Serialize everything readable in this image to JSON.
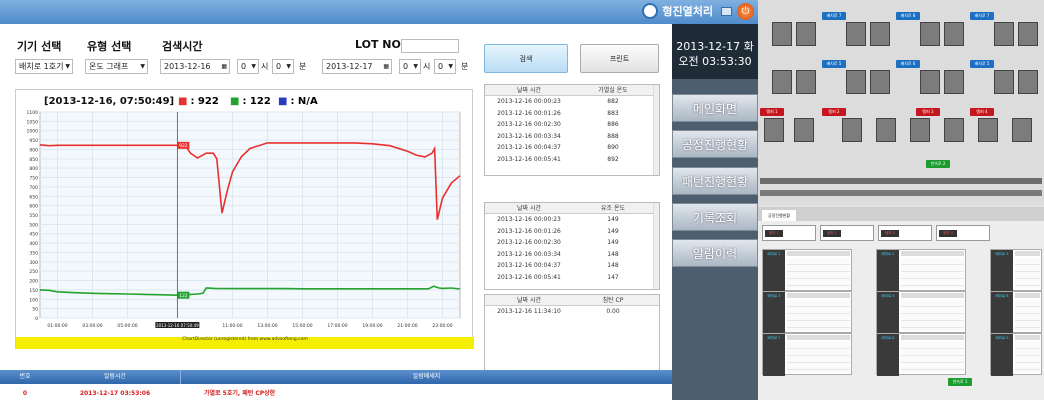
{
  "header": {
    "brand": "형진열처리"
  },
  "filters": {
    "device_label": "기기 선택",
    "type_label": "유형 선택",
    "time_label": "검색시간",
    "lot_label": "LOT NO",
    "device_value": "배치로 1호기",
    "type_value": "온도 그래프",
    "start_date": "2013-12-16",
    "start_hour": "0",
    "start_min": "0",
    "end_date": "2013-12-17",
    "end_hour": "0",
    "end_min": "0",
    "hour_unit": "시",
    "min_unit": "분",
    "lot_value": ""
  },
  "buttons": {
    "search": "검색",
    "print": "프린트"
  },
  "chart_readout": {
    "timestamp": "[2013-12-16,  07:50:49]",
    "red_label": "■",
    "red_value": ": 922",
    "green_label": "■",
    "green_value": ": 122",
    "blue_label": "■",
    "blue_value": ": N/A",
    "cursor_tag": "2013-12-16 07:50:49",
    "red_marker": "922",
    "green_marker": "122",
    "attribution": "ChartDirector (unregistered) from www.advsofteng.com"
  },
  "chart_data": {
    "type": "line",
    "ylim": [
      0,
      1100
    ],
    "y_ticks": [
      0,
      50,
      100,
      150,
      200,
      250,
      300,
      350,
      400,
      450,
      500,
      550,
      600,
      650,
      700,
      750,
      800,
      850,
      900,
      950,
      1000,
      1050,
      1100
    ],
    "x_ticks": [
      "01:00:00",
      "03:00:00",
      "05:00:00",
      "2013-12-16 07:50:49",
      "11:00:00",
      "13:00:00",
      "15:00:00",
      "17:00:00",
      "19:00:00",
      "21:00:00",
      "23:00:00"
    ],
    "grid": true,
    "series": [
      {
        "color": "#e8312f",
        "x": [
          0,
          0.5,
          1,
          2,
          3,
          4,
          5,
          6,
          7,
          7.85,
          8.3,
          8.6,
          9,
          9.5,
          9.9,
          10.1,
          10.4,
          10.7,
          11,
          11.5,
          12,
          13,
          14,
          15,
          16,
          17,
          18,
          19,
          20,
          21,
          21.5,
          22,
          22.4,
          22.55,
          22.7,
          23,
          23.5,
          24
        ],
        "y": [
          925,
          920,
          922,
          922,
          922,
          922,
          922,
          922,
          922,
          922,
          921,
          880,
          855,
          880,
          880,
          850,
          560,
          680,
          780,
          860,
          905,
          935,
          935,
          935,
          935,
          935,
          935,
          930,
          920,
          890,
          870,
          860,
          880,
          905,
          525,
          640,
          720,
          760
        ]
      },
      {
        "color": "#22a32e",
        "x": [
          0,
          0.5,
          1,
          2,
          3,
          4,
          5,
          6,
          7,
          7.85,
          8.5,
          9,
          9.3,
          9.5,
          10,
          11,
          12,
          13,
          14,
          15,
          16,
          17,
          18,
          19,
          20,
          21,
          22,
          22.2,
          22.5,
          22.8,
          23,
          23.5,
          24
        ],
        "y": [
          150,
          148,
          140,
          135,
          132,
          130,
          128,
          126,
          124,
          122,
          125,
          128,
          132,
          160,
          158,
          157,
          157,
          157,
          157,
          156,
          156,
          156,
          156,
          156,
          156,
          156,
          156,
          156,
          170,
          160,
          158,
          160,
          155
        ]
      },
      {
        "color": "#2a3bbf",
        "x": [],
        "y": []
      }
    ]
  },
  "tables": [
    {
      "col1": "날짜 시간",
      "col2": "가열실 온도",
      "rows": [
        [
          "2013-12-16 00:00:23",
          "882"
        ],
        [
          "2013-12-16 00:01:26",
          "883"
        ],
        [
          "2013-12-16 00:02:30",
          "886"
        ],
        [
          "2013-12-16 00:03:34",
          "888"
        ],
        [
          "2013-12-16 00:04:37",
          "890"
        ],
        [
          "2013-12-16 00:05:41",
          "892"
        ]
      ]
    },
    {
      "col1": "날짜 시간",
      "col2": "유조 온도",
      "rows": [
        [
          "2013-12-16 00:00:23",
          "149"
        ],
        [
          "2013-12-16 00:01:26",
          "149"
        ],
        [
          "2013-12-16 00:02:30",
          "149"
        ],
        [
          "2013-12-16 00:03:34",
          "148"
        ],
        [
          "2013-12-16 00:04:37",
          "148"
        ],
        [
          "2013-12-16 00:05:41",
          "147"
        ]
      ]
    },
    {
      "col1": "날짜 시간",
      "col2": "침탄 CP",
      "rows": [
        [
          "2013-12-16 11:34:10",
          "0.00"
        ]
      ]
    }
  ],
  "alarm": {
    "col_no": "번호",
    "col_time": "알람시간",
    "col_msg": "알람메세지",
    "rows": [
      {
        "no": "0",
        "time": "2013-12-17 03:53:06",
        "msg": "가열로 5호기,  패턴 CP상한"
      }
    ]
  },
  "nav": {
    "date": "2013-12-17 화",
    "time": "오전 03:53:30",
    "items": [
      "메인화면",
      "공정진행현황",
      "패턴진행현황",
      "기록조회",
      "알람이력"
    ]
  },
  "overview": {
    "tab": "공정진행현황",
    "blue_tags": [
      "배치로 7",
      "배치로 8",
      "배치로 5",
      "배치로 6"
    ],
    "red_tags": [
      "템퍼 1",
      "템퍼 2",
      "템퍼 3",
      "템퍼 4"
    ],
    "green_tag": "연속로 2",
    "panels": [
      "템퍼 1",
      "템퍼 2",
      "템퍼 3",
      "템퍼 4"
    ],
    "groups": [
      "배치로 1",
      "배치로 2",
      "배치로 3",
      "배치로 4",
      "배치로 5",
      "배치로 6",
      "배치로 7",
      "배치로 8",
      "배치로 9"
    ],
    "bottom_tag": "연속로 1"
  }
}
